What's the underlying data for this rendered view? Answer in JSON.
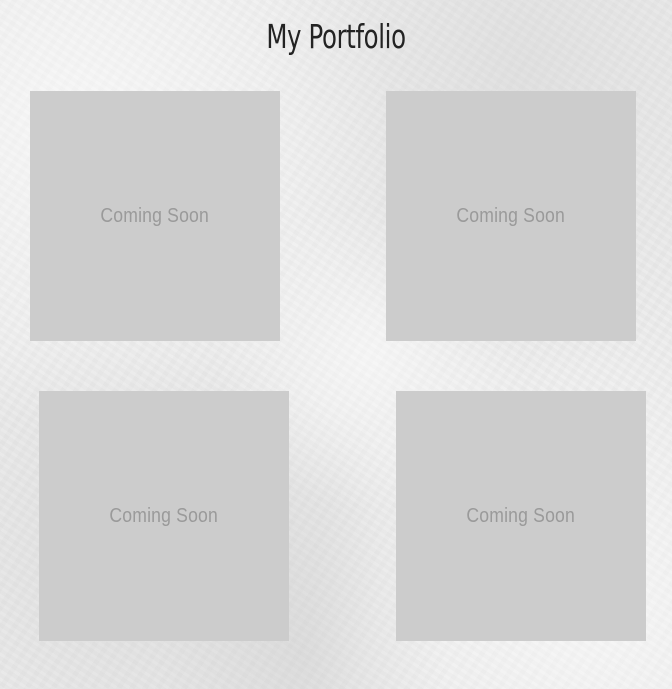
{
  "header": {
    "title": "My Portfolio"
  },
  "portfolio": {
    "items": [
      {
        "label": "Coming Soon"
      },
      {
        "label": "Coming Soon"
      },
      {
        "label": "Coming Soon"
      },
      {
        "label": "Coming Soon"
      }
    ]
  },
  "colors": {
    "background": "#ececec",
    "tile": "#cccccc",
    "tile_text": "#9a9a9a",
    "title_text": "#232323"
  }
}
